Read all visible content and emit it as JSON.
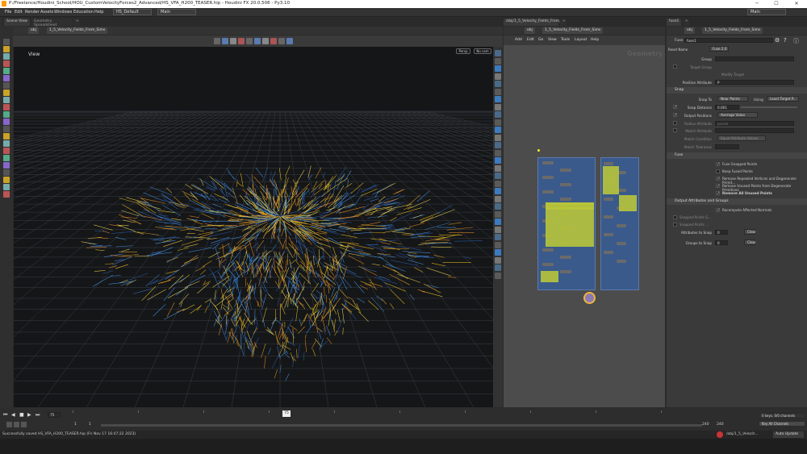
{
  "window": {
    "title": "P:/Freelance/Houdini_School/HOU_CustomVelocityForces2_Advanced/HS_VFA_H200_TEASER.hip - Houdini FX 20.0.506 - Py3.10",
    "min": "─",
    "max": "☐",
    "close": "✕"
  },
  "menubar": {
    "items": [
      "File",
      "Edit",
      "Render",
      "Assets",
      "Windows",
      "Education",
      "Help"
    ],
    "desktop_left": "HS_Default",
    "desktop_mid": "Main",
    "desktop_right": "Main"
  },
  "left_pane": {
    "tabs": [
      "Scene View",
      "Geometry Spreadsheet"
    ],
    "path_obj": "obj",
    "path_node": "1_5_Velocity_Fields_From_Sims",
    "view_label": "View",
    "persp_btn": "Persp",
    "cam_btn": "No cam"
  },
  "network_pane": {
    "tab": "/obj/1_5_Velocity_Fields_From_...",
    "path_obj": "obj",
    "path_node": "1_5_Velocity_Fields_From_Sims",
    "menu": [
      "Add",
      "Edit",
      "Go",
      "View",
      "Tools",
      "Layout",
      "Help"
    ],
    "context_label": "Geometry"
  },
  "params_pane": {
    "tab": "fuse1",
    "path_obj": "obj",
    "path_node": "1_5_Velocity_Fields_From_Sims",
    "node_type": "Fuse",
    "node_name": "fuse1",
    "reset_name": "Reset Name",
    "fuse_version": "Fuse 2.0",
    "group_label": "Group",
    "target_group_label": "Target Group",
    "modify_target_label": "Modify Target",
    "position_attr_label": "Position Attribute",
    "position_attr_value": "P",
    "snap_section": "Snap",
    "snap_to_label": "Snap To",
    "snap_to_value": "Near Points",
    "using_label": "Using",
    "using_value": "Least Target P...",
    "snap_distance_label": "Snap Distance",
    "snap_distance_value": "0.001",
    "output_positions_label": "Output Positions",
    "output_positions_value": "Average Value",
    "radius_attr_label": "Radius Attribute",
    "radius_attr_value": "pscale",
    "match_attr_label": "Match Attribute",
    "match_cond_label": "Match Condition",
    "match_cond_value": "Equal Attribute Values",
    "match_tol_label": "Match Tolerance",
    "fuse_section": "Fuse",
    "fuse_opts": [
      "Fuse Snapped Points",
      "Keep Fused Points",
      "Remove Repeated Vertices and Degenerate Primit...",
      "Remove Unused Points from Degenerate Primitives",
      "Remove All Unused Points"
    ],
    "output_section": "Output Attributes and Groups",
    "recompute_label": "Recompute Affected Normals",
    "snapped_points_label": "Snapped Points G...",
    "snapped_pts_label": "Snapped Points ...",
    "attrs_to_snap_label": "Attributes to Snap",
    "attrs_to_snap_value": "0",
    "clear_label": "Clear",
    "groups_to_snap_label": "Groups to Snap",
    "groups_to_snap_value": "0"
  },
  "timeline": {
    "frame": "75",
    "start": "1",
    "start2": "1",
    "end": "240",
    "end2": "240",
    "ticks": [
      "24",
      "48",
      "72",
      "96",
      "120",
      "144",
      "168",
      "192",
      "216",
      "240"
    ],
    "keys_label": "0 keys, 0/0 channels",
    "key_all": "Key All Channels",
    "auto_update": "Auto Update",
    "status_path": "/obj/1_5_Velocit..."
  },
  "status": {
    "message": "Successfully saved HS_VFA_H200_TEASER.hip (Fri Nov 17 16:47:22 2023)"
  },
  "colors": {
    "viewport_bg": "#151618",
    "net_bg": "#4c4c4c",
    "subnet_blue": "#3a5a8c",
    "node_yellow": "#b7c43a"
  }
}
